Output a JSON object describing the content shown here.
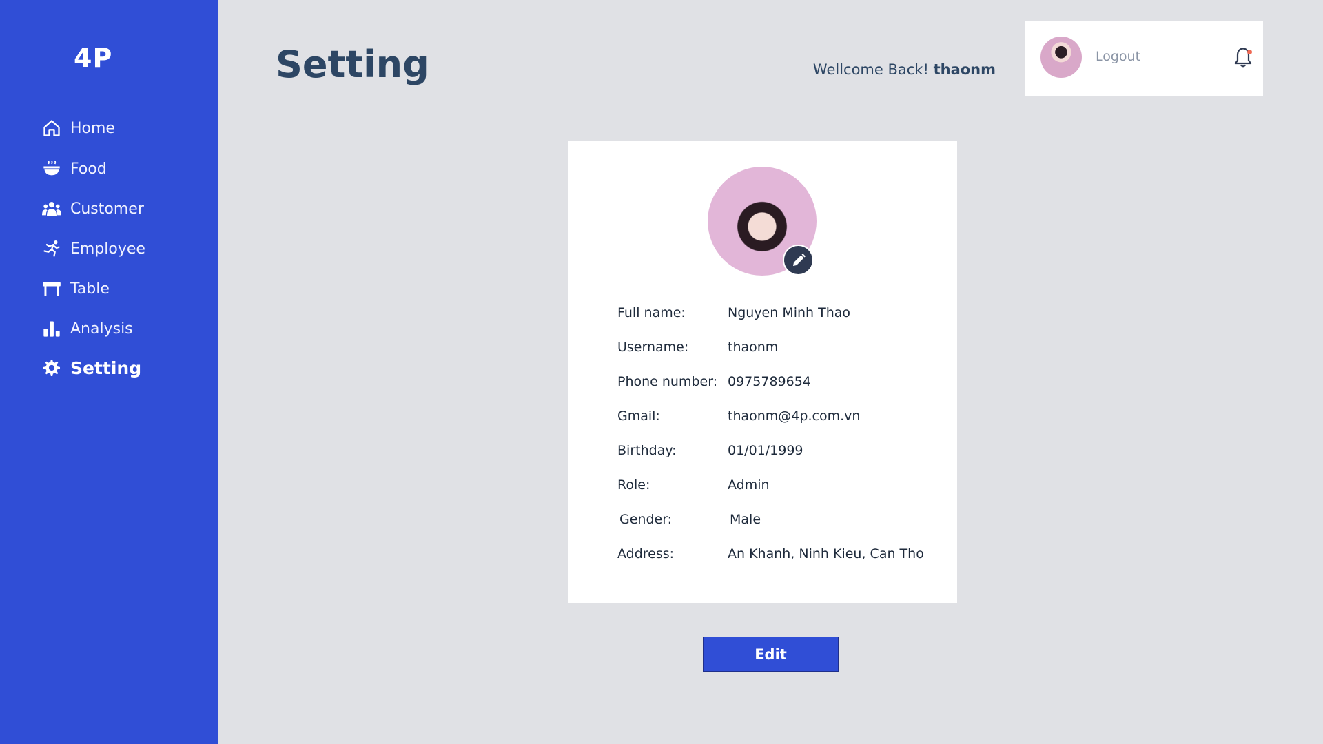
{
  "app": {
    "logo": "4P"
  },
  "sidebar": {
    "items": [
      {
        "label": "Home",
        "icon": "home-icon",
        "active": false
      },
      {
        "label": "Food",
        "icon": "food-bowl-icon",
        "active": false
      },
      {
        "label": "Customer",
        "icon": "users-icon",
        "active": false
      },
      {
        "label": "Employee",
        "icon": "running-person-icon",
        "active": false
      },
      {
        "label": "Table",
        "icon": "table-icon",
        "active": false
      },
      {
        "label": "Analysis",
        "icon": "bar-chart-icon",
        "active": false
      },
      {
        "label": "Setting",
        "icon": "gear-icon",
        "active": true
      }
    ]
  },
  "header": {
    "title": "Setting",
    "welcome_text": "Wellcome Back!",
    "username": "thaonm",
    "logout_label": "Logout"
  },
  "profile": {
    "fields": [
      {
        "label": "Full name:",
        "value": "Nguyen Minh Thao"
      },
      {
        "label": "Username:",
        "value": "thaonm"
      },
      {
        "label": "Phone number:",
        "value": "0975789654"
      },
      {
        "label": "Gmail:",
        "value": "thaonm@4p.com.vn"
      },
      {
        "label": "Birthday:",
        "value": "01/01/1999"
      },
      {
        "label": "Role:",
        "value": "Admin"
      },
      {
        "label": "Gender:",
        "value": "Male"
      },
      {
        "label": "Address:",
        "value": "An Khanh, Ninh Kieu, Can Tho"
      }
    ]
  },
  "actions": {
    "edit_label": "Edit"
  },
  "colors": {
    "sidebar": "#304ed6",
    "background": "#e0e1e5",
    "title": "#2d4664",
    "notification_dot": "#ef6a55"
  }
}
